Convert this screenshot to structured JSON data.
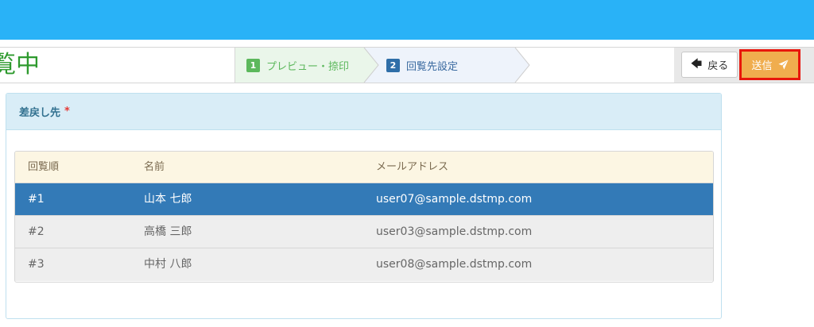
{
  "header": {
    "title": "覧中"
  },
  "steps": [
    {
      "number": "1",
      "label": "プレビュー・捺印"
    },
    {
      "number": "2",
      "label": "回覧先設定"
    }
  ],
  "actions": {
    "back_label": "戻る",
    "send_label": "送信"
  },
  "panel": {
    "title": "差戻し先",
    "required_mark": "*"
  },
  "table": {
    "columns": [
      "回覧順",
      "名前",
      "メールアドレス"
    ],
    "rows": [
      {
        "order": "#1",
        "name": "山本 七郎",
        "email": "user07@sample.dstmp.com",
        "selected": true
      },
      {
        "order": "#2",
        "name": "高橋 三郎",
        "email": "user03@sample.dstmp.com",
        "selected": false
      },
      {
        "order": "#3",
        "name": "中村 八郎",
        "email": "user08@sample.dstmp.com",
        "selected": false
      }
    ]
  },
  "colors": {
    "topbar": "#29b2f7",
    "title": "#2e9a2e",
    "step_active": "#5cb85c",
    "step_next": "#2f6ea8",
    "send_button": "#f0ad4e",
    "highlight_border": "#e8160c",
    "selected_row": "#337ab7",
    "panel_header": "#d9edf7"
  },
  "icons": {
    "back": "arrow-left-icon",
    "send": "paper-plane-icon"
  }
}
